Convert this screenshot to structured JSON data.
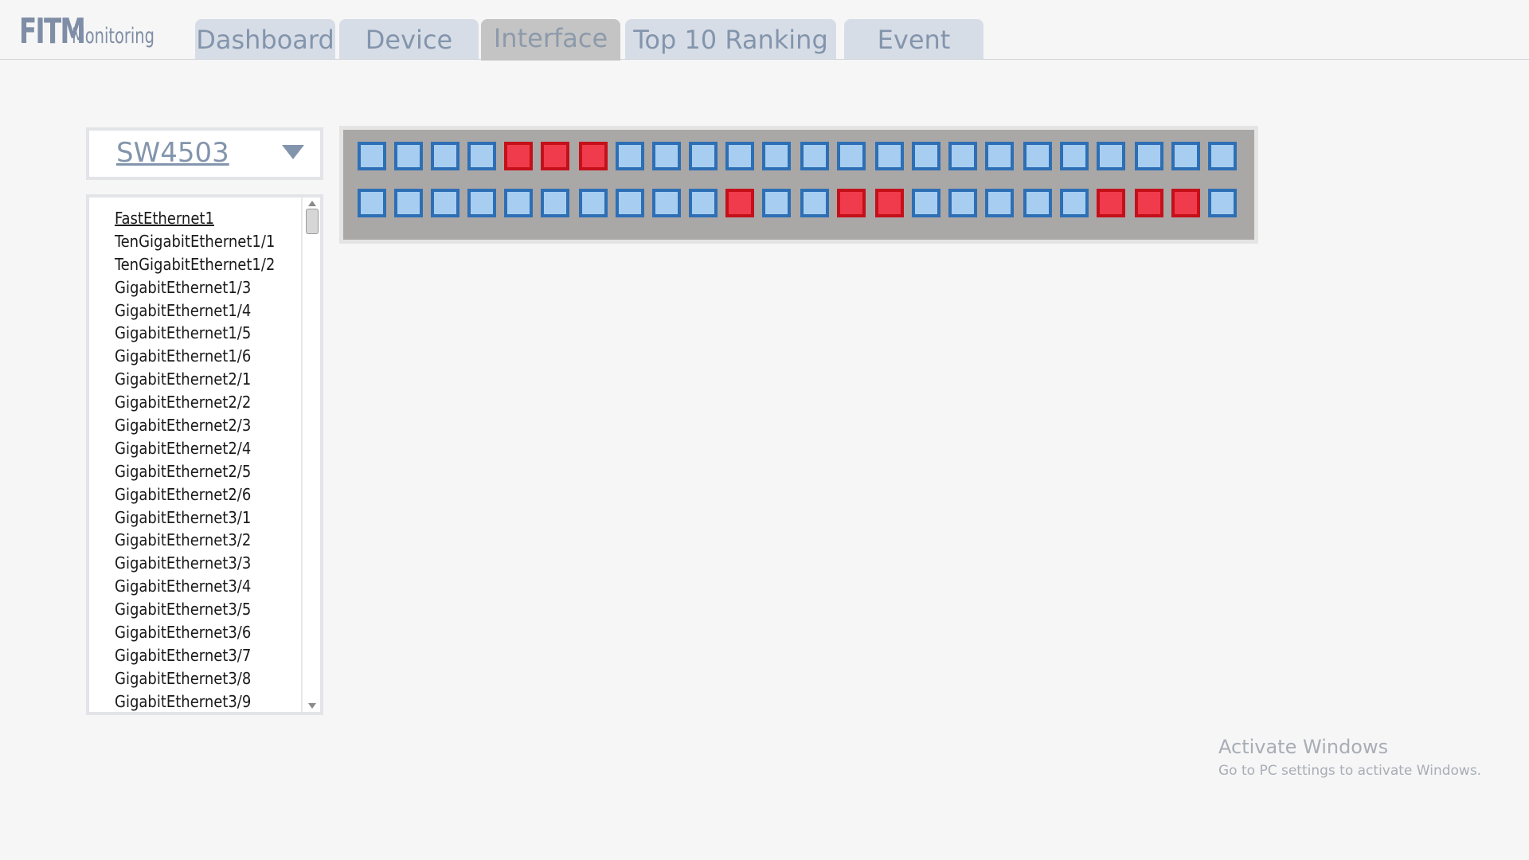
{
  "app": {
    "logo_main": "FITM",
    "logo_sub": "Monitoring"
  },
  "tabs": [
    {
      "label": "Dashboard",
      "active": false
    },
    {
      "label": "Device",
      "active": false
    },
    {
      "label": "Interface",
      "active": true
    },
    {
      "label": "Top 10 Ranking",
      "active": false
    },
    {
      "label": "Event",
      "active": false
    }
  ],
  "device_select": {
    "value": "SW4503"
  },
  "interfaces": [
    "FastEthernet1",
    "TenGigabitEthernet1/1",
    "TenGigabitEthernet1/2",
    "GigabitEthernet1/3",
    "GigabitEthernet1/4",
    "GigabitEthernet1/5",
    "GigabitEthernet1/6",
    "GigabitEthernet2/1",
    "GigabitEthernet2/2",
    "GigabitEthernet2/3",
    "GigabitEthernet2/4",
    "GigabitEthernet2/5",
    "GigabitEthernet2/6",
    "GigabitEthernet3/1",
    "GigabitEthernet3/2",
    "GigabitEthernet3/3",
    "GigabitEthernet3/4",
    "GigabitEthernet3/5",
    "GigabitEthernet3/6",
    "GigabitEthernet3/7",
    "GigabitEthernet3/8",
    "GigabitEthernet3/9"
  ],
  "ports": {
    "status_colors": {
      "up": "#a7cdf0",
      "down": "#ef3b4b"
    },
    "row1": [
      "up",
      "up",
      "up",
      "up",
      "down",
      "down",
      "down",
      "up",
      "up",
      "up",
      "up",
      "up",
      "up",
      "up",
      "up",
      "up",
      "up",
      "up",
      "up",
      "up",
      "up",
      "up",
      "up",
      "up"
    ],
    "row2": [
      "up",
      "up",
      "up",
      "up",
      "up",
      "up",
      "up",
      "up",
      "up",
      "up",
      "down",
      "up",
      "up",
      "down",
      "down",
      "up",
      "up",
      "up",
      "up",
      "up",
      "down",
      "down",
      "down",
      "up"
    ]
  },
  "watermark": {
    "title": "Activate Windows",
    "subtitle": "Go to PC settings to activate Windows."
  }
}
